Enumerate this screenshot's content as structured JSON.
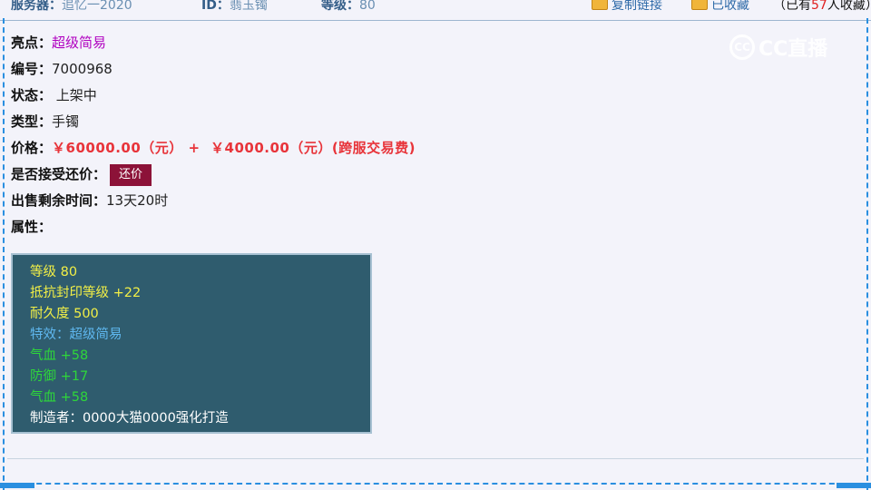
{
  "topbar": {
    "server_label": "服务器：",
    "server_value": "追忆一2020",
    "id_label": "ID：",
    "id_value": "翡玉镯",
    "level_label": "等级：",
    "level_value": "80",
    "copy_link": "复制链接",
    "favorited": "已收藏",
    "fav_prefix": "（已有",
    "fav_count": "57",
    "fav_suffix": "人收藏）",
    "icon_copy": "copy-link-icon",
    "icon_fav": "favorite-icon"
  },
  "watermark": {
    "text": "CC直播",
    "logo_glyph": "CC"
  },
  "details": {
    "highlight_label": "亮点：",
    "highlight_value": "超级简易",
    "number_label": "编号：",
    "number_value": "7000968",
    "status_label": "状态：",
    "status_value": " 上架中",
    "type_label": "类型：",
    "type_value": "手镯",
    "price_label": "价格：",
    "price_value": "￥60000.00（元） +  ￥4000.00（元）(跨服交易费)",
    "counter_label": "是否接受还价：",
    "counter_button": "还价",
    "time_label": "出售剩余时间：",
    "time_value": "13天20时",
    "attr_label": "属性："
  },
  "attributes": [
    {
      "text": "等级 80",
      "color": "#f2ef46"
    },
    {
      "text": "抵抗封印等级 +22",
      "color": "#f2ef46"
    },
    {
      "text": "耐久度 500",
      "color": "#f2ef46"
    },
    {
      "text": "特效：超级简易",
      "color": "#5fb8f0"
    },
    {
      "text": "气血 +58",
      "color": "#2ed63a"
    },
    {
      "text": "防御 +17",
      "color": "#2ed63a"
    },
    {
      "text": "气血 +58",
      "color": "#2ed63a"
    },
    {
      "text": "制造者：0000大猫0000强化打造",
      "color": "#ffffff"
    }
  ],
  "colors": {
    "background": "#f3f3fa",
    "accent": "#2a8fe0",
    "price_red": "#e8343a",
    "counter_button_bg": "#8c1238",
    "attr_box_bg": "#2f5c6e"
  }
}
